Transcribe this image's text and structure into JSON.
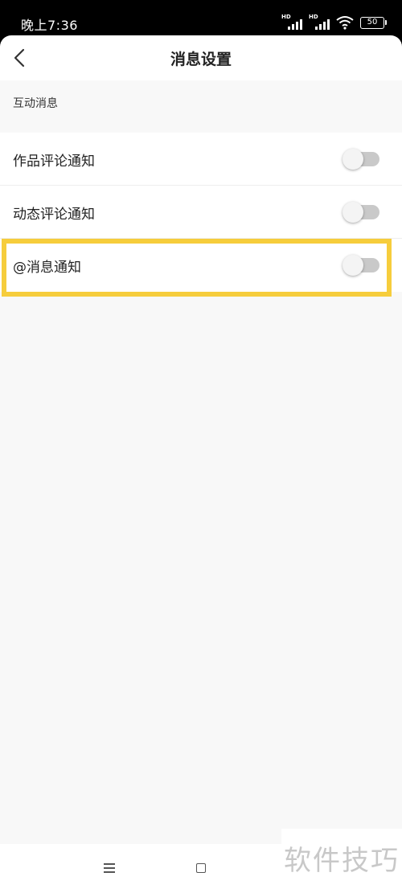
{
  "status_bar": {
    "time": "晚上7:36",
    "signal1_label": "HD",
    "signal2_label": "HD",
    "battery": "50",
    "icons": [
      "signal-icon",
      "signal-icon",
      "wifi-icon",
      "battery-icon"
    ]
  },
  "header": {
    "title": "消息设置",
    "back_icon": "chevron-left-icon"
  },
  "section": {
    "label": "互动消息"
  },
  "settings": [
    {
      "label": "作品评论通知",
      "enabled": false
    },
    {
      "label": "动态评论通知",
      "enabled": false
    },
    {
      "label": "@消息通知",
      "enabled": false
    }
  ],
  "nav": {
    "icons": [
      "menu-icon",
      "home-icon"
    ]
  },
  "watermark": "软件技巧",
  "colors": {
    "highlight": "#f6cd3c",
    "toggle_track_off": "#c9c9c9",
    "background": "#f8f8f8"
  }
}
